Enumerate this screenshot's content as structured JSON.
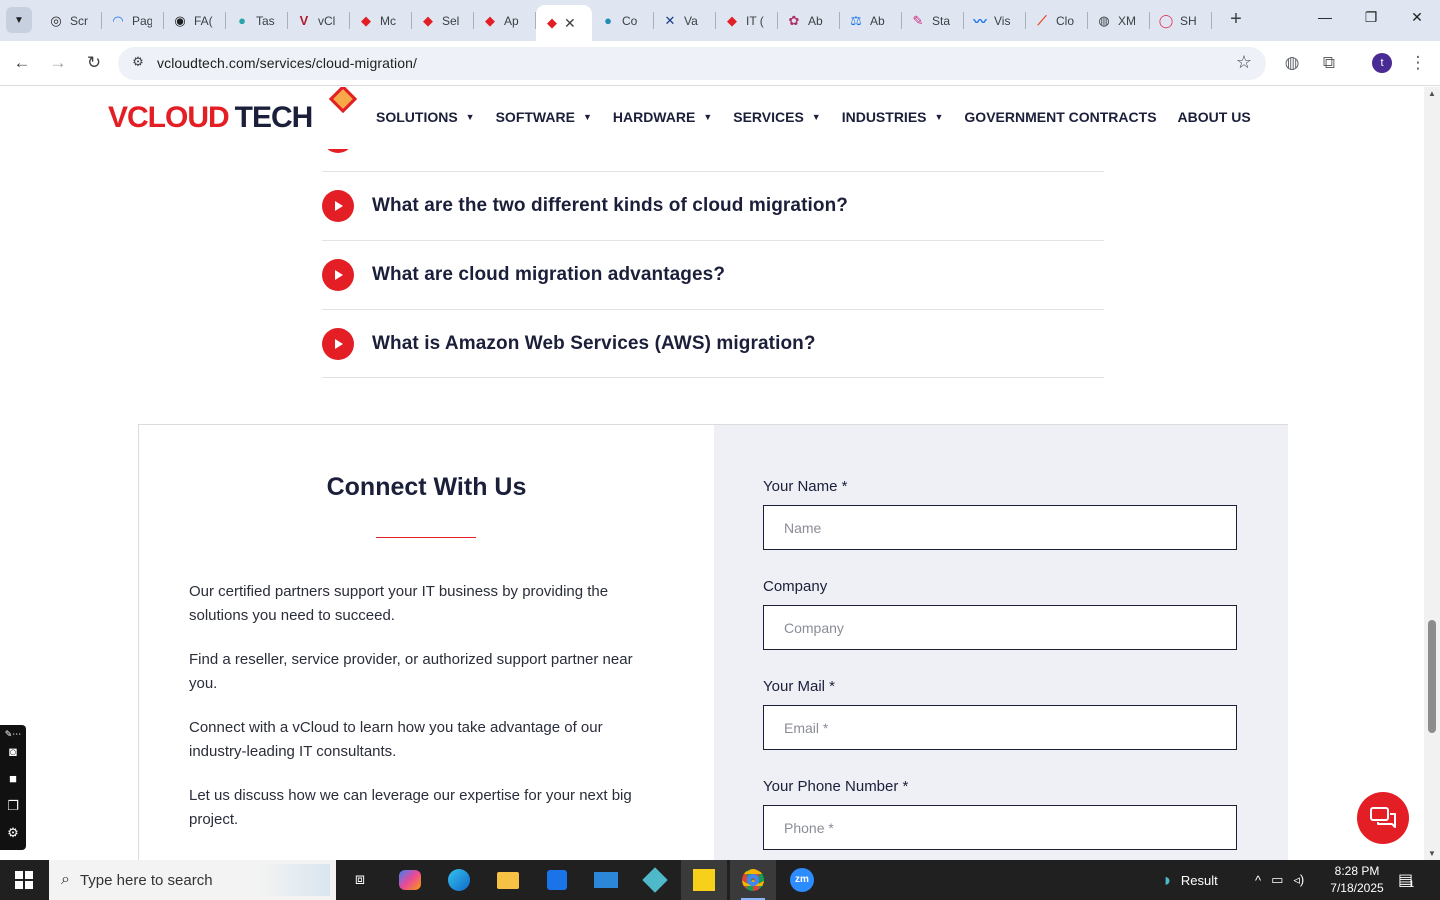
{
  "browser": {
    "tabs": [
      {
        "title": "Scr",
        "color": "#1f1f1f",
        "glyph": "◎"
      },
      {
        "title": "Pag",
        "color": "#1a73e8",
        "glyph": "◠"
      },
      {
        "title": "FA(",
        "color": "#1f1f1f",
        "glyph": "◉"
      },
      {
        "title": "Tas",
        "color": "#2aa5a8",
        "glyph": "●"
      },
      {
        "title": "vCl",
        "color": "#b01b2e",
        "glyph": "V"
      },
      {
        "title": "Mc",
        "color": "#e31e24",
        "glyph": "◆"
      },
      {
        "title": "Sel",
        "color": "#e31e24",
        "glyph": "◆"
      },
      {
        "title": "Ap",
        "color": "#e31e24",
        "glyph": "◆"
      },
      {
        "title": "",
        "color": "#e31e24",
        "glyph": "◆",
        "active": true
      },
      {
        "title": "Co",
        "color": "#1f8fb5",
        "glyph": "●"
      },
      {
        "title": "Va",
        "color": "#1a3a8a",
        "glyph": "✕"
      },
      {
        "title": "IT (",
        "color": "#e31e24",
        "glyph": "◆"
      },
      {
        "title": "Ab",
        "color": "#b0306a",
        "glyph": "✿"
      },
      {
        "title": "Ab",
        "color": "#1a73e8",
        "glyph": "⚖"
      },
      {
        "title": "Sta",
        "color": "#d0237a",
        "glyph": "✎"
      },
      {
        "title": "Vis",
        "color": "#1a73e8",
        "glyph": "〰"
      },
      {
        "title": "Clo",
        "color": "#e34b1e",
        "glyph": "⟋"
      },
      {
        "title": "XM",
        "color": "#3c4043",
        "glyph": "◍"
      },
      {
        "title": "SH",
        "color": "#e3345a",
        "glyph": "◯"
      }
    ],
    "url": "vcloudtech.com/services/cloud-migration/",
    "profile_initial": "t"
  },
  "site": {
    "logo_v": "V",
    "logo_cloud": "CLOUD",
    "logo_tech": "TECH",
    "nav": [
      {
        "label": "SOLUTIONS",
        "caret": true
      },
      {
        "label": "SOFTWARE",
        "caret": true
      },
      {
        "label": "HARDWARE",
        "caret": true
      },
      {
        "label": "SERVICES",
        "caret": true
      },
      {
        "label": "INDUSTRIES",
        "caret": true
      },
      {
        "label": "GOVERNMENT CONTRACTS",
        "caret": false
      },
      {
        "label": "ABOUT US",
        "caret": false
      }
    ]
  },
  "faq": [
    "What are the two different kinds of cloud migration?",
    "What are cloud migration advantages?",
    "What is Amazon Web Services (AWS) migration?"
  ],
  "contact": {
    "title": "Connect With Us",
    "paragraphs": [
      "Our certified partners support your IT business by providing the solutions you need to succeed.",
      "Find a reseller, service provider, or authorized support partner near you.",
      "Connect with a vCloud to learn how you take advantage of our industry-leading IT consultants.",
      "Let us discuss how we can leverage our expertise for your next big project."
    ],
    "form": {
      "name_label": "Your Name *",
      "name_placeholder": "Name",
      "company_label": "Company",
      "company_placeholder": "Company",
      "mail_label": "Your Mail *",
      "mail_placeholder": "Email *",
      "phone_label": "Your Phone Number *",
      "phone_placeholder": "Phone *"
    }
  },
  "taskbar": {
    "search_placeholder": "Type here to search",
    "weather_label": "Result",
    "time": "8:28 PM",
    "date": "7/18/2025",
    "notification_count": "1"
  },
  "colors": {
    "brand_red": "#e31e24",
    "navy": "#1b1f3a",
    "form_panel": "#eef0f5"
  }
}
